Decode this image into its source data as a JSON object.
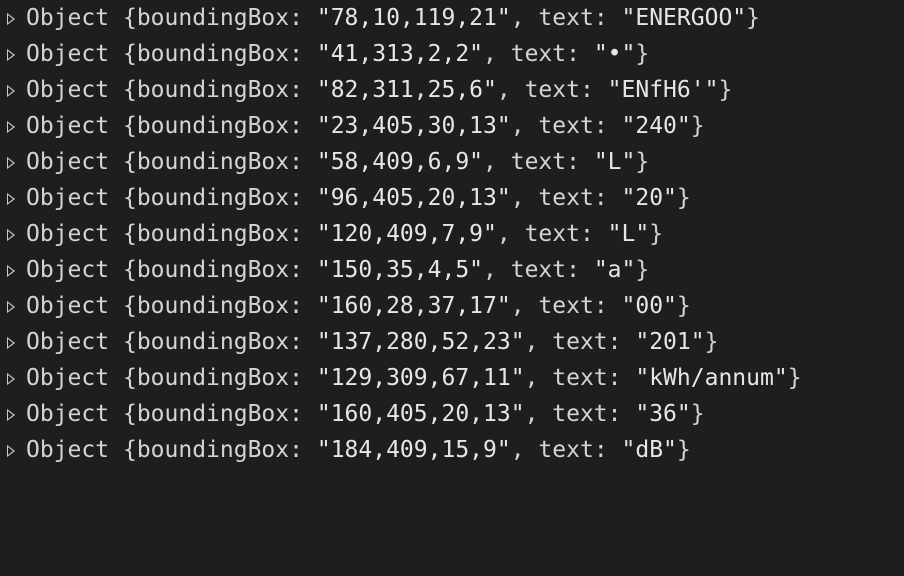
{
  "rows": [
    {
      "type_name": "Object",
      "key1": "boundingBox",
      "val1": "\"78,10,119,21\"",
      "key2": "text",
      "val2": "\"ENERGOO\""
    },
    {
      "type_name": "Object",
      "key1": "boundingBox",
      "val1": "\"41,313,2,2\"",
      "key2": "text",
      "val2": "\"•\""
    },
    {
      "type_name": "Object",
      "key1": "boundingBox",
      "val1": "\"82,311,25,6\"",
      "key2": "text",
      "val2": "\"ENfH6'\""
    },
    {
      "type_name": "Object",
      "key1": "boundingBox",
      "val1": "\"23,405,30,13\"",
      "key2": "text",
      "val2": "\"240\""
    },
    {
      "type_name": "Object",
      "key1": "boundingBox",
      "val1": "\"58,409,6,9\"",
      "key2": "text",
      "val2": "\"L\""
    },
    {
      "type_name": "Object",
      "key1": "boundingBox",
      "val1": "\"96,405,20,13\"",
      "key2": "text",
      "val2": "\"20\""
    },
    {
      "type_name": "Object",
      "key1": "boundingBox",
      "val1": "\"120,409,7,9\"",
      "key2": "text",
      "val2": "\"L\""
    },
    {
      "type_name": "Object",
      "key1": "boundingBox",
      "val1": "\"150,35,4,5\"",
      "key2": "text",
      "val2": "\"a\""
    },
    {
      "type_name": "Object",
      "key1": "boundingBox",
      "val1": "\"160,28,37,17\"",
      "key2": "text",
      "val2": "\"00\""
    },
    {
      "type_name": "Object",
      "key1": "boundingBox",
      "val1": "\"137,280,52,23\"",
      "key2": "text",
      "val2": "\"201\""
    },
    {
      "type_name": "Object",
      "key1": "boundingBox",
      "val1": "\"129,309,67,11\"",
      "key2": "text",
      "val2": "\"kWh/annum\""
    },
    {
      "type_name": "Object",
      "key1": "boundingBox",
      "val1": "\"160,405,20,13\"",
      "key2": "text",
      "val2": "\"36\""
    },
    {
      "type_name": "Object",
      "key1": "boundingBox",
      "val1": "\"184,409,15,9\"",
      "key2": "text",
      "val2": "\"dB\""
    }
  ],
  "colors": {
    "background": "#1e1e1e",
    "text": "#d4d4d4",
    "expand_arrow": "#cccccc"
  },
  "icons": {
    "row_toggle": "disclosure-triangle-right"
  }
}
